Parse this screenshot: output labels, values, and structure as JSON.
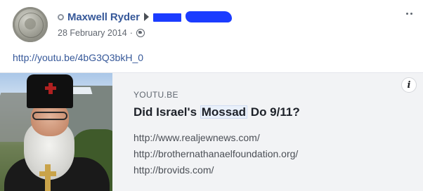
{
  "post": {
    "author_name": "Maxwell Ryder",
    "date": "28 February 2014",
    "date_separator": "·",
    "link_text": "http://youtu.be/4bG3Q3bkH_0"
  },
  "card": {
    "domain": "YOUTU.BE",
    "title_before": "Did Israel's ",
    "title_highlight": "Mossad",
    "title_after": " Do 9/11?",
    "description_lines": [
      "http://www.realjewnews.com/",
      "http://brothernathanaelfoundation.org/",
      "http://brovids.com/"
    ],
    "info_label": "i"
  },
  "icons": {
    "status": "status-dot-icon",
    "share": "triangle-right-icon",
    "privacy": "globe-icon",
    "more": "more-options-icon",
    "info": "info-icon"
  },
  "colors": {
    "link": "#365899",
    "meta": "#616770",
    "card_bg": "#f2f3f5",
    "redaction": "#1b3cff"
  }
}
